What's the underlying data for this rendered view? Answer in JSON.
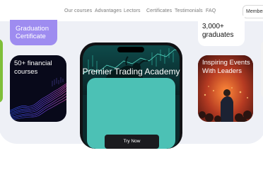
{
  "nav": {
    "links": [
      "Our courses",
      "Advantages",
      "Lectors",
      "Certificates",
      "Testimonials",
      "FAQ"
    ],
    "member_label": "Member a"
  },
  "cards": {
    "graduation": "Graduation Certificate",
    "financial": "50+ financial courses",
    "graduates": "3,000+ graduates",
    "events": "Inspiring Events With Leaders"
  },
  "hero": {
    "title": "Premier Trading Academy",
    "cta": "Try Now"
  },
  "colors": {
    "accent_purple": "#9e8cf0",
    "teal": "#4cc1b5",
    "green": "#7fbf3a",
    "dark": "#1b1b1f"
  }
}
